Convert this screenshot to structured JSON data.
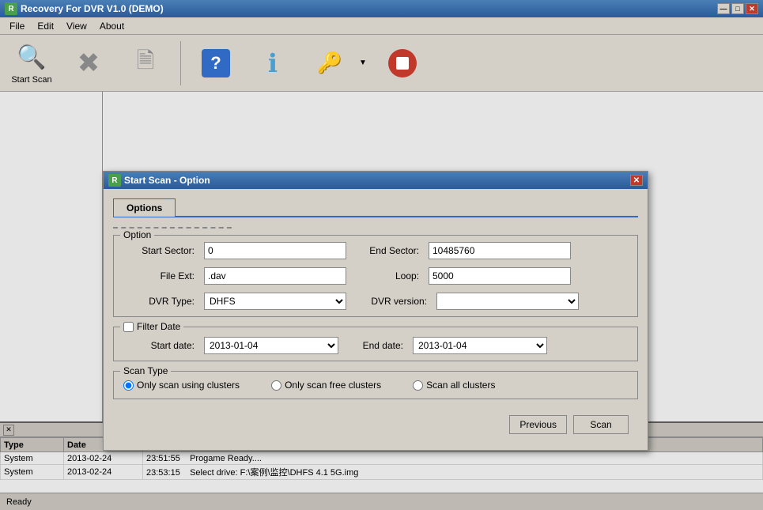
{
  "app": {
    "title": "Recovery For DVR V1.0 (DEMO)",
    "title_icon": "R",
    "min_btn": "—",
    "max_btn": "□",
    "close_btn": "✕"
  },
  "menu": {
    "items": [
      "File",
      "Edit",
      "View",
      "About"
    ]
  },
  "toolbar": {
    "buttons": [
      {
        "id": "start-scan",
        "label": "Start Scan",
        "icon": "🔍"
      },
      {
        "id": "cancel",
        "label": "",
        "icon": "✕"
      },
      {
        "id": "open",
        "label": "",
        "icon": "📄"
      },
      {
        "id": "help",
        "label": "",
        "icon": "?"
      },
      {
        "id": "info",
        "label": "",
        "icon": "ℹ"
      },
      {
        "id": "key",
        "label": "",
        "icon": "🔑"
      },
      {
        "id": "stop",
        "label": "",
        "icon": "⛔"
      }
    ]
  },
  "dialog": {
    "title": "Start Scan - Option",
    "close_btn": "✕",
    "tab": "Options",
    "option_group_label": "Option",
    "fields": {
      "start_sector_label": "Start Sector:",
      "start_sector_value": "0",
      "end_sector_label": "End Sector:",
      "end_sector_value": "10485760",
      "file_ext_label": "File Ext:",
      "file_ext_value": ".dav",
      "loop_label": "Loop:",
      "loop_value": "5000",
      "dvr_type_label": "DVR Type:",
      "dvr_type_value": "DHFS",
      "dvr_type_options": [
        "DHFS"
      ],
      "dvr_version_label": "DVR version:",
      "dvr_version_value": "",
      "dvr_version_options": []
    },
    "filter_date": {
      "label": "Filter Date",
      "checkbox": false,
      "start_date_label": "Start date:",
      "start_date_value": "2013-01-04",
      "end_date_label": "End date:",
      "end_date_value": "2013-01-04"
    },
    "scan_type": {
      "label": "Scan Type",
      "options": [
        {
          "id": "using-clusters",
          "label": "Only scan using clusters",
          "selected": true
        },
        {
          "id": "free-clusters",
          "label": "Only scan free clusters",
          "selected": false
        },
        {
          "id": "all-clusters",
          "label": "Scan all clusters",
          "selected": false
        }
      ]
    },
    "buttons": {
      "previous": "Previous",
      "scan": "Scan"
    }
  },
  "log": {
    "close_icon": "✕",
    "columns": [
      "Type",
      "Date",
      ""
    ],
    "rows": [
      {
        "type": "System",
        "date": "2013-02-24",
        "time": "23:51:55",
        "message": "Progame Ready...."
      },
      {
        "type": "System",
        "date": "2013-02-24",
        "time": "23:53:15",
        "message": "Select drive: F:\\案例\\监控\\DHFS 4.1 5G.img"
      }
    ]
  },
  "status": {
    "text": "Ready"
  }
}
